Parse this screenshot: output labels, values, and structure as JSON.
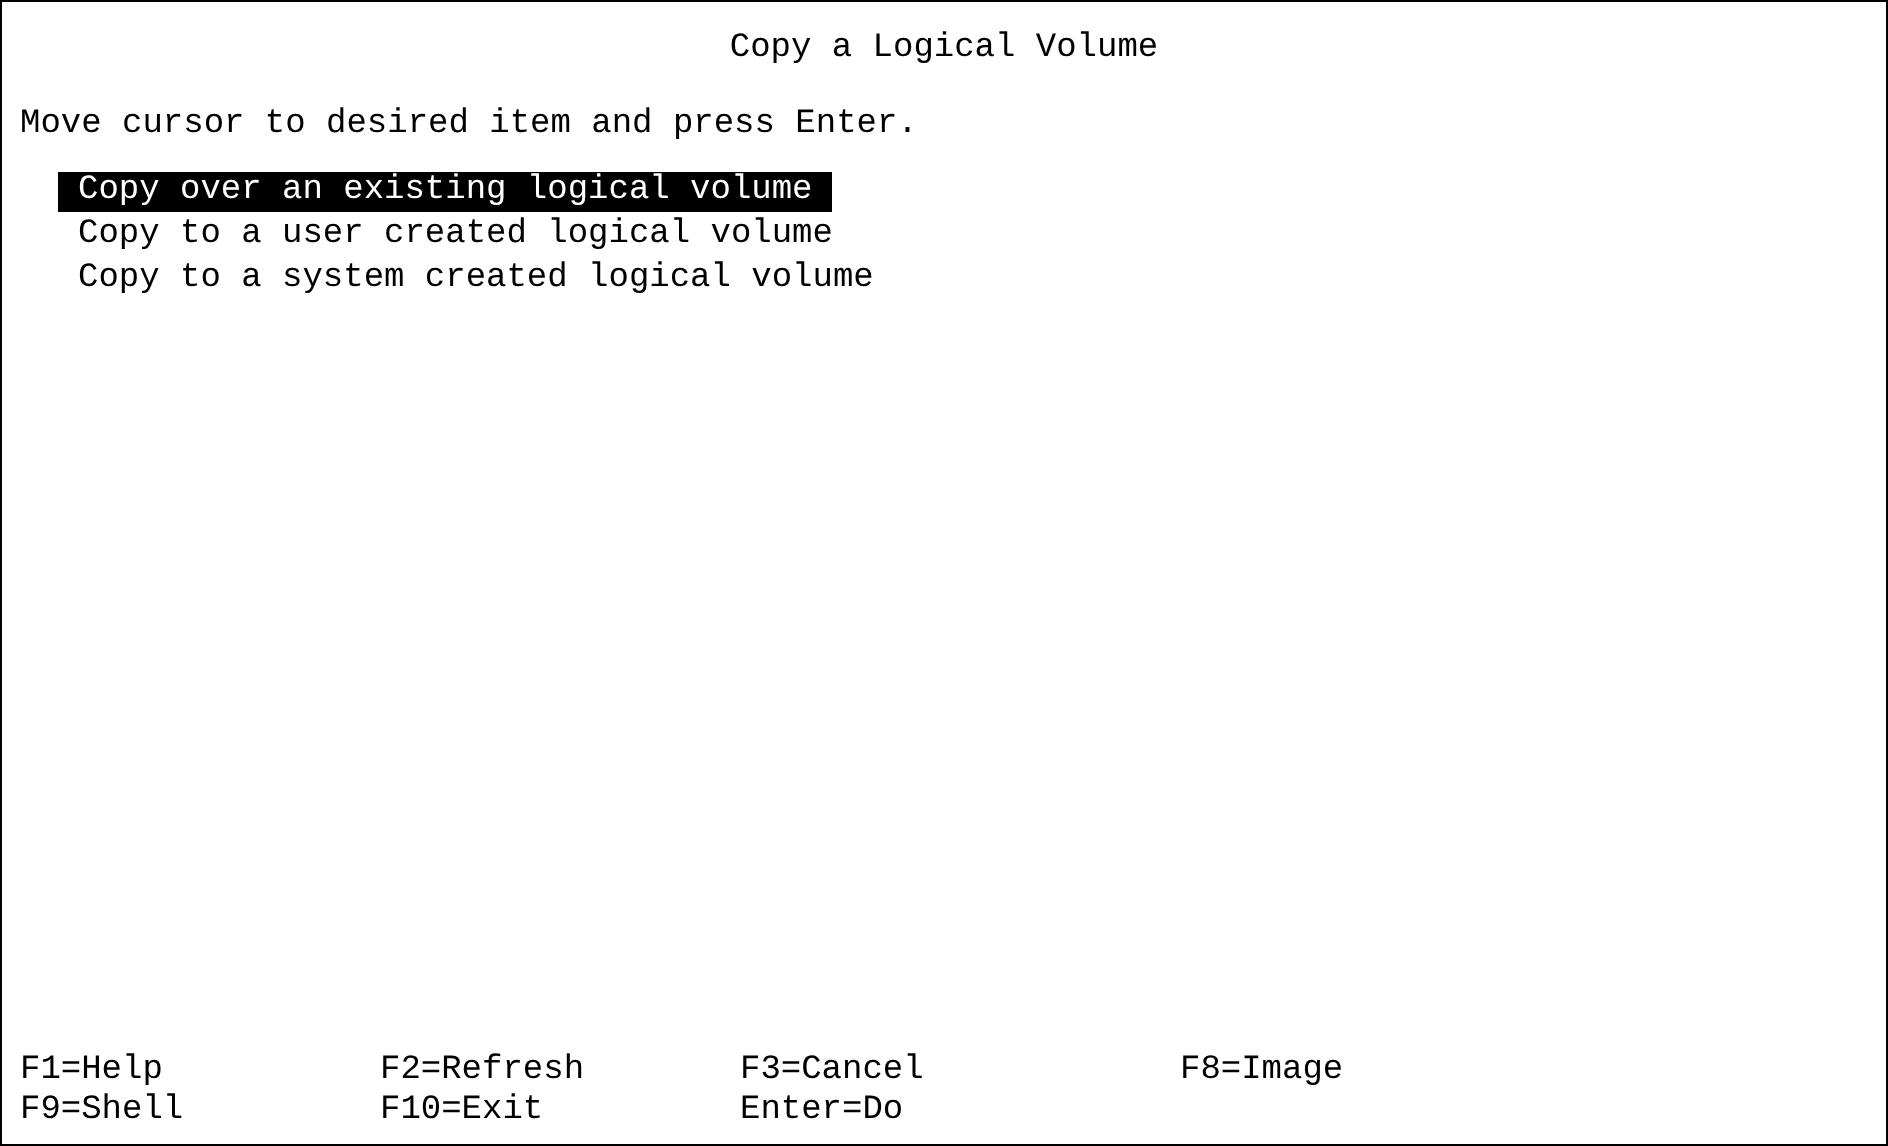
{
  "window": {
    "title": "Copy a Logical Volume"
  },
  "instruction": "Move cursor to desired item and press Enter.",
  "menu_items": [
    {
      "label": "Copy over an existing logical volume",
      "selected": true
    },
    {
      "label": "Copy to a user created logical volume",
      "selected": false
    },
    {
      "label": "Copy to a system created logical volume",
      "selected": false
    }
  ],
  "function_keys": [
    {
      "label": "F1=Help"
    },
    {
      "label": "F2=Refresh"
    },
    {
      "label": "F3=Cancel"
    },
    {
      "label": "F8=Image"
    },
    {
      "label": "F9=Shell"
    },
    {
      "label": "F10=Exit"
    },
    {
      "label": "Enter=Do"
    }
  ]
}
